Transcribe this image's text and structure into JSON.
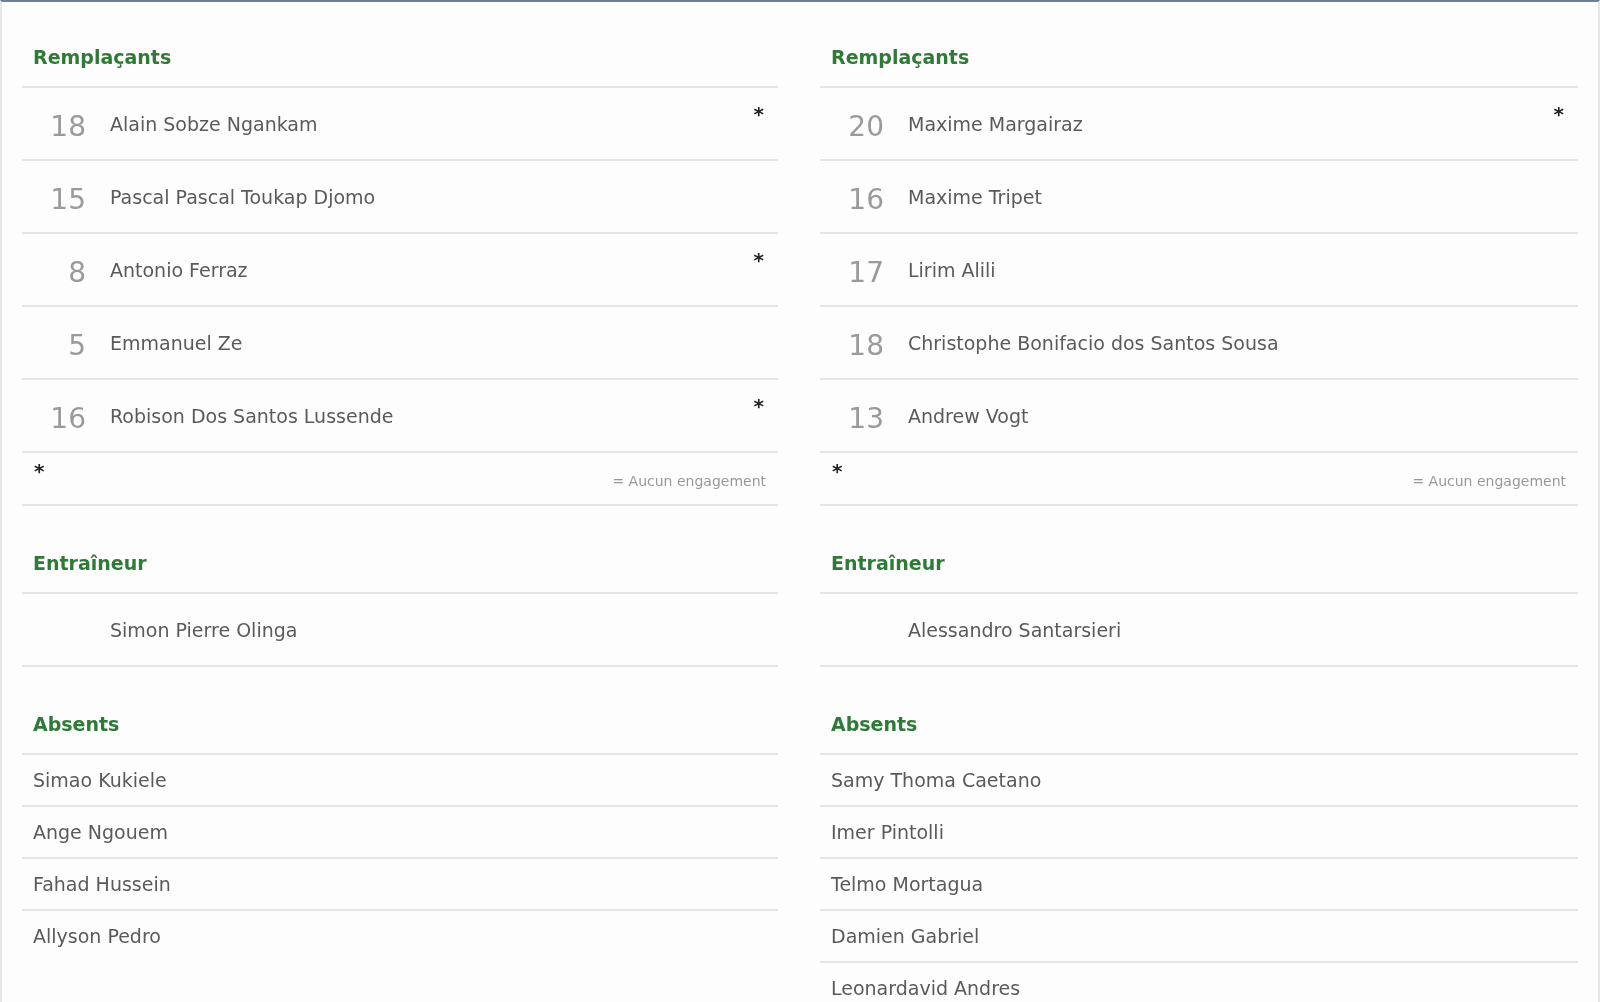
{
  "teams": [
    {
      "substitutes": {
        "title": "Remplaçants",
        "players": [
          {
            "number": "18",
            "name": "Alain Sobze Ngankam",
            "note": "*"
          },
          {
            "number": "15",
            "name": "Pascal Pascal Toukap Djomo"
          },
          {
            "number": "8",
            "name": "Antonio Ferraz",
            "note": "*"
          },
          {
            "number": "5",
            "name": "Emmanuel Ze"
          },
          {
            "number": "16",
            "name": "Robison Dos Santos Lussende",
            "note": "*"
          }
        ],
        "legend_mark": "*",
        "legend": "= Aucun engagement"
      },
      "coach": {
        "title": "Entraîneur",
        "name": "Simon Pierre Olinga"
      },
      "absents": {
        "title": "Absents",
        "players": [
          "Simao Kukiele",
          "Ange Ngouem",
          "Fahad Hussein",
          "Allyson Pedro"
        ]
      }
    },
    {
      "substitutes": {
        "title": "Remplaçants",
        "players": [
          {
            "number": "20",
            "name": "Maxime Margairaz",
            "note": "*"
          },
          {
            "number": "16",
            "name": "Maxime Tripet"
          },
          {
            "number": "17",
            "name": "Lirim Alili"
          },
          {
            "number": "18",
            "name": "Christophe Bonifacio dos Santos Sousa"
          },
          {
            "number": "13",
            "name": "Andrew Vogt"
          }
        ],
        "legend_mark": "*",
        "legend": "= Aucun engagement"
      },
      "coach": {
        "title": "Entraîneur",
        "name": "Alessandro Santarsieri"
      },
      "absents": {
        "title": "Absents",
        "players": [
          "Samy Thoma Caetano",
          "Imer Pintolli",
          "Telmo Mortagua",
          "Damien Gabriel",
          "Leonardavid Andres"
        ]
      }
    }
  ]
}
